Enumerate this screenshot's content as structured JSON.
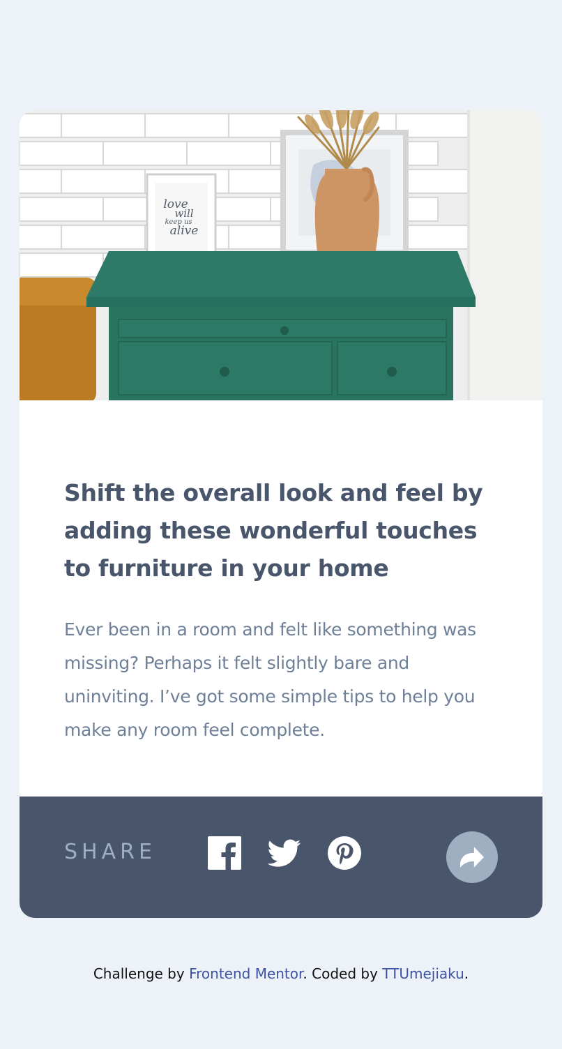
{
  "card": {
    "image": {
      "frame_text": [
        "love",
        "will",
        "keep us",
        "alive"
      ]
    },
    "title": "Shift the overall look and feel by adding these wonderful touches to furniture in your home",
    "description": "Ever been in a room and felt like something was missing? Perhaps it felt slightly bare and uninviting. I’ve got some simple tips to help you make any room feel complete.",
    "share": {
      "label": "SHARE",
      "icons": [
        "facebook-icon",
        "twitter-icon",
        "pinterest-icon",
        "share-arrow-icon"
      ]
    }
  },
  "footer": {
    "prefix": "Challenge by ",
    "challenge_link": "Frontend Mentor",
    "middle": ". Coded by ",
    "author_link": "TTUmejiaku",
    "suffix": "."
  },
  "colors": {
    "background": "#ecf2f8",
    "card": "#ffffff",
    "title": "#48556a",
    "body_text": "#6e8098",
    "share_bar": "#48556a",
    "share_label": "#9eafc2",
    "share_button": "#9eafc2",
    "link": "#3e52a3"
  }
}
